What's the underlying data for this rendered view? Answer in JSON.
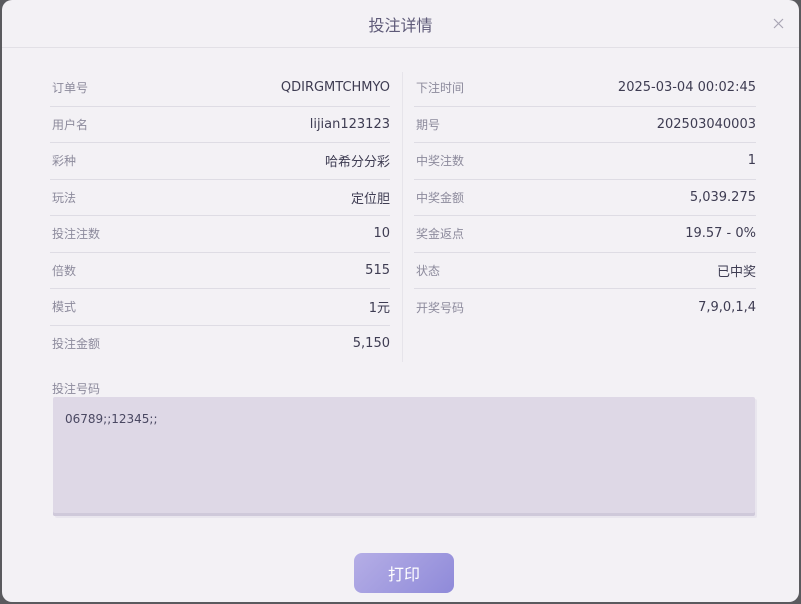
{
  "dialog": {
    "title": "投注详情"
  },
  "left_rows": [
    {
      "label": "订单号",
      "value": "QDIRGMTCHMYO"
    },
    {
      "label": "用户名",
      "value": "lijian123123"
    },
    {
      "label": "彩种",
      "value": "哈希分分彩"
    },
    {
      "label": "玩法",
      "value": "定位胆"
    },
    {
      "label": "投注注数",
      "value": "10"
    },
    {
      "label": "倍数",
      "value": "515"
    },
    {
      "label": "模式",
      "value": "1元"
    },
    {
      "label": "投注金额",
      "value": "5,150"
    }
  ],
  "right_rows": [
    {
      "label": "下注时间",
      "value": "2025-03-04 00:02:45"
    },
    {
      "label": "期号",
      "value": "202503040003"
    },
    {
      "label": "中奖注数",
      "value": "1"
    },
    {
      "label": "中奖金额",
      "value": "5,039.275"
    },
    {
      "label": "奖金返点",
      "value": "19.57 - 0%"
    },
    {
      "label": "状态",
      "value": "已中奖"
    },
    {
      "label": "开奖号码",
      "value": "7,9,0,1,4"
    }
  ],
  "bet_numbers": {
    "label": "投注号码",
    "value": "06789;;12345;;"
  },
  "print_button": {
    "label": "打印"
  },
  "icons": {
    "close": "close-icon"
  }
}
